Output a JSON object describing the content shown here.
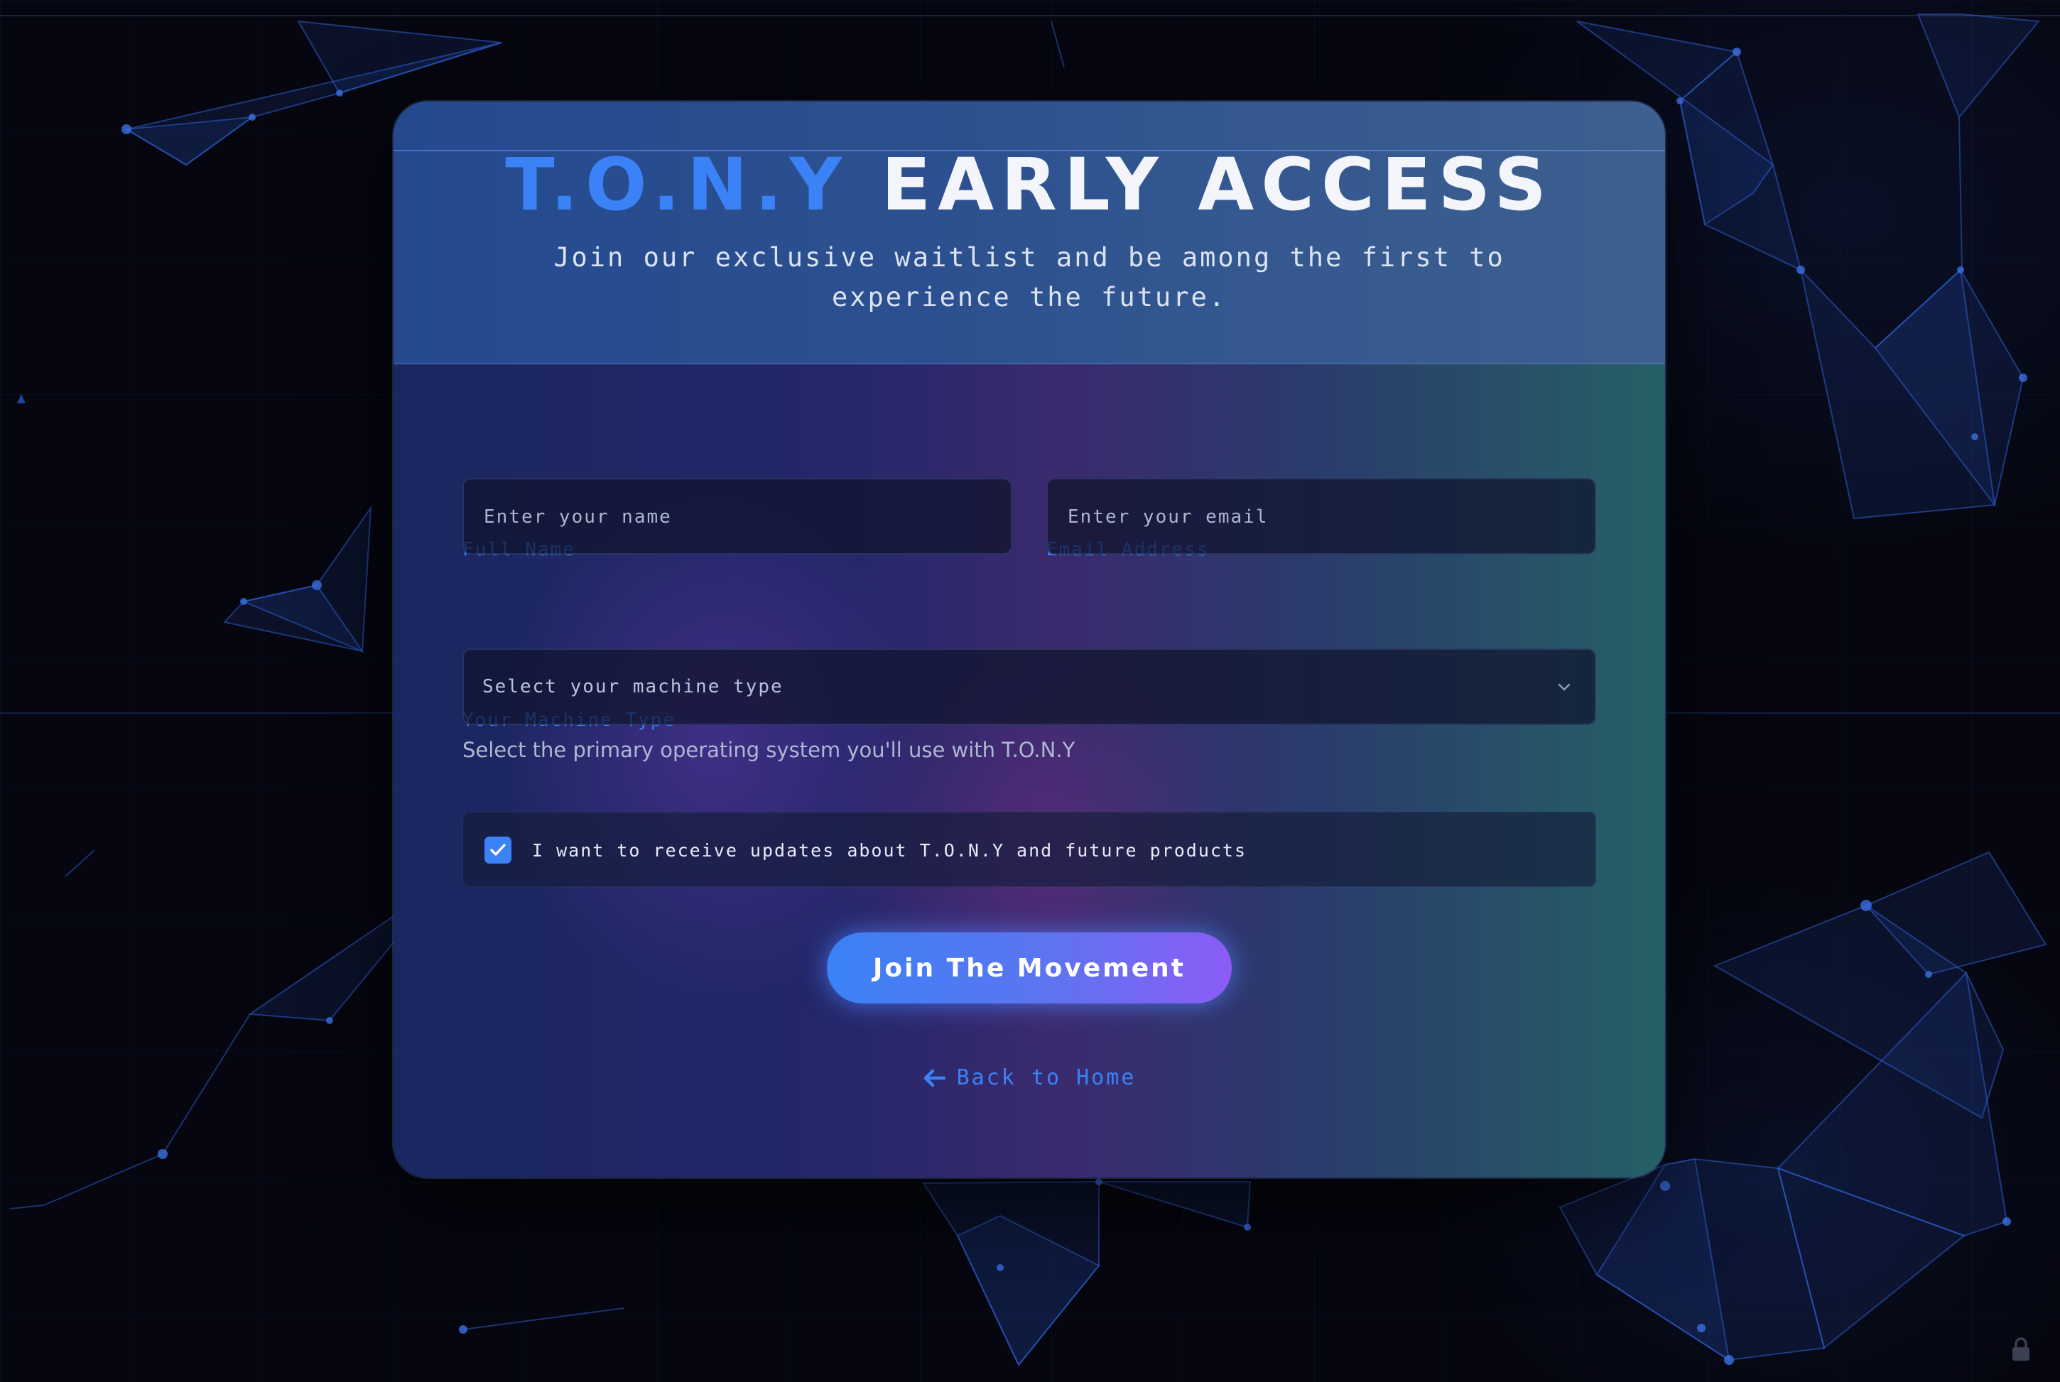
{
  "header": {
    "title_brand": "T.O.N.Y",
    "title_rest": "EARLY ACCESS",
    "subtitle": "Join our exclusive waitlist and be among the first to experience the future."
  },
  "form": {
    "name": {
      "label": "Full Name",
      "placeholder": "Enter your name",
      "value": ""
    },
    "email": {
      "label": "Email Address",
      "placeholder": "Enter your email",
      "value": ""
    },
    "machine": {
      "label": "Your Machine Type",
      "selected": "Select your machine type",
      "help": "Select the primary operating system you'll use with T.O.N.Y"
    },
    "updates": {
      "checked": true,
      "label": "I want to receive updates about T.O.N.Y and future products"
    },
    "submit_label": "Join The Movement"
  },
  "back_link": {
    "label": "Back to Home",
    "icon": "arrow-left-icon"
  },
  "footer": {
    "icon": "lock-icon"
  },
  "colors": {
    "accent": "#3b82f6",
    "accent_purple": "#8b5cf6",
    "background": "#05060f"
  }
}
